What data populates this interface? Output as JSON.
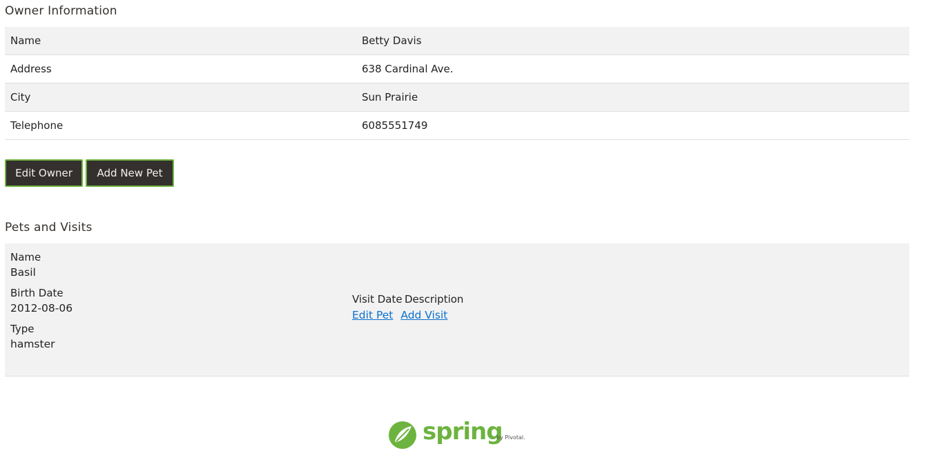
{
  "owner_section": {
    "heading": "Owner Information",
    "rows": [
      {
        "label": "Name",
        "value": "Betty Davis"
      },
      {
        "label": "Address",
        "value": "638 Cardinal Ave."
      },
      {
        "label": "City",
        "value": "Sun Prairie"
      },
      {
        "label": "Telephone",
        "value": "6085551749"
      }
    ],
    "edit_owner_label": "Edit Owner",
    "add_new_pet_label": "Add New Pet"
  },
  "pets_section": {
    "heading": "Pets and Visits",
    "pet": {
      "name_label": "Name",
      "name": "Basil",
      "birth_date_label": "Birth Date",
      "birth_date": "2012-08-06",
      "type_label": "Type",
      "type": "hamster"
    },
    "visits": {
      "visit_date_header": "Visit Date",
      "description_header": "Description",
      "edit_pet_label": "Edit Pet",
      "add_visit_label": "Add Visit"
    }
  },
  "footer": {
    "logo_word": "spring",
    "logo_sub": "by Pivotal."
  },
  "colors": {
    "brand_green": "#6db33f",
    "button_dark": "#34302d",
    "link_blue": "#0a70d0",
    "stripe_gray": "#f2f2f2"
  }
}
